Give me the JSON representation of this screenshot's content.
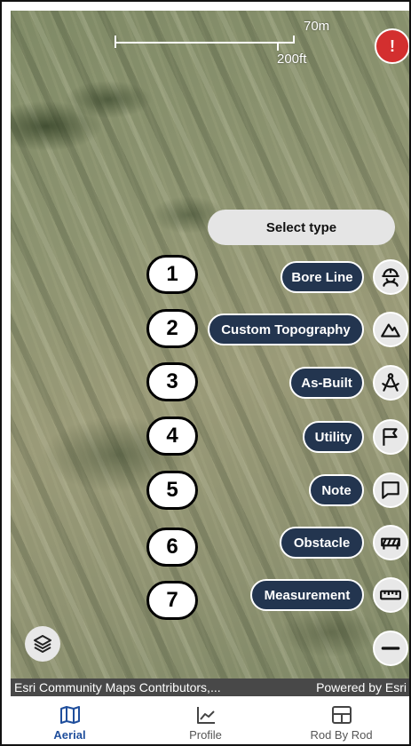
{
  "scale": {
    "metric_label": "70m",
    "imperial_label": "200ft"
  },
  "alert": {
    "icon": "alert-badge-icon",
    "mark": "!"
  },
  "select_type_label": "Select type",
  "menu": [
    {
      "number": "1",
      "label": "Bore Line",
      "icon": "worker-helmet-icon"
    },
    {
      "number": "2",
      "label": "Custom Topography",
      "icon": "mountain-icon"
    },
    {
      "number": "3",
      "label": "As-Built",
      "icon": "compass-drafting-icon"
    },
    {
      "number": "4",
      "label": "Utility",
      "icon": "flag-icon"
    },
    {
      "number": "5",
      "label": "Note",
      "icon": "speech-bubble-icon"
    },
    {
      "number": "6",
      "label": "Obstacle",
      "icon": "barrier-icon"
    },
    {
      "number": "7",
      "label": "Measurement",
      "icon": "ruler-icon"
    }
  ],
  "close_icon": "minus-circle-icon",
  "layers_icon": "layers-icon",
  "attribution": {
    "left": "Esri Community Maps Contributors,...",
    "right": "Powered by Esri"
  },
  "nav": [
    {
      "label": "Aerial",
      "icon": "map-icon",
      "active": true
    },
    {
      "label": "Profile",
      "icon": "chart-icon",
      "active": false
    },
    {
      "label": "Rod By Rod",
      "icon": "grid-icon",
      "active": false
    }
  ],
  "colors": {
    "pill": "#23354f",
    "accent": "#1f4e9c",
    "alert": "#d32f2f"
  }
}
